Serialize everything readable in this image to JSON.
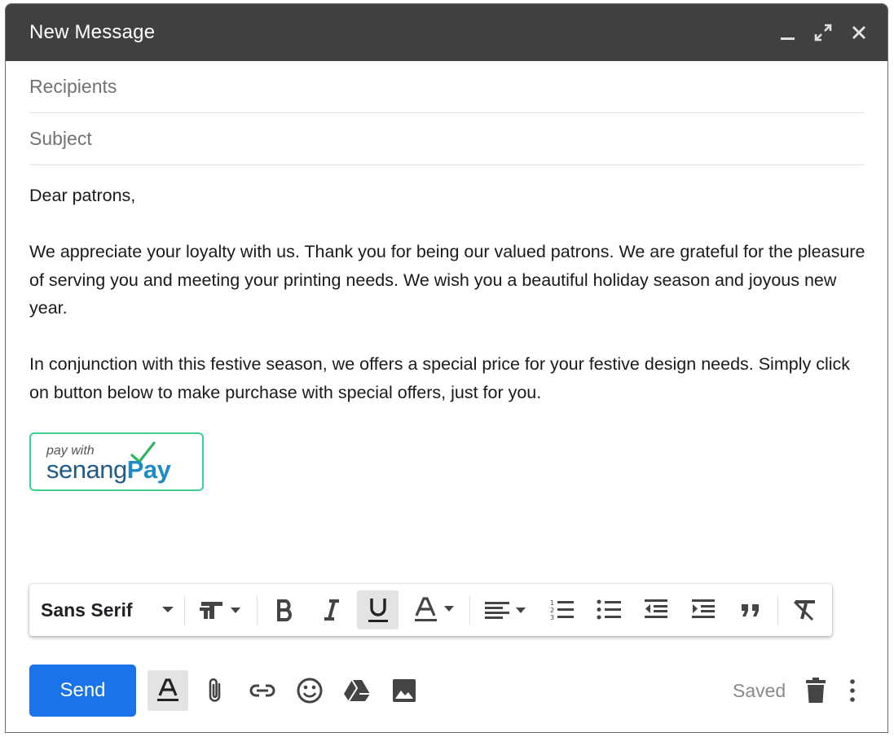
{
  "window": {
    "title": "New Message",
    "controls": [
      "minimize-icon",
      "expand-icon",
      "close-icon"
    ]
  },
  "recipients": {
    "placeholder": "Recipients",
    "value": ""
  },
  "subject": {
    "placeholder": "Subject",
    "value": ""
  },
  "body": {
    "greeting": "Dear patrons,",
    "paragraph1": "We appreciate your loyalty with us. Thank you for being our valued patrons. We are grateful for the pleasure of serving you and meeting your printing needs. We wish you a beautiful holiday season and joyous new year.",
    "paragraph2": "In conjunction with this festive season, we offers a special price for your festive design needs. Simply click on button below to make purchase with special offers, just for you."
  },
  "pay_button": {
    "small_text": "pay with",
    "brand_part1": "senang",
    "brand_part2": "Pay",
    "colors": {
      "border": "#3ecf8e",
      "senang": "#1f5c87",
      "pay": "#1e8bc3",
      "check": "#2fb560"
    }
  },
  "formatting_toolbar": {
    "font_family": "Sans Serif",
    "items": [
      "text-size-icon",
      "bold-icon",
      "italic-icon",
      "underline-icon",
      "text-color-icon",
      "align-icon",
      "numbered-list-icon",
      "bulleted-list-icon",
      "indent-less-icon",
      "indent-more-icon",
      "quote-icon",
      "remove-formatting-icon"
    ],
    "active": "underline-icon"
  },
  "bottom_bar": {
    "send_label": "Send",
    "saved_label": "Saved",
    "tools": [
      "formatting-options-icon",
      "attach-icon",
      "link-icon",
      "emoji-icon",
      "drive-icon",
      "photo-icon",
      "trash-icon",
      "more-options-icon"
    ]
  },
  "colors": {
    "titlebar": "#404040",
    "send": "#1a73e8"
  }
}
